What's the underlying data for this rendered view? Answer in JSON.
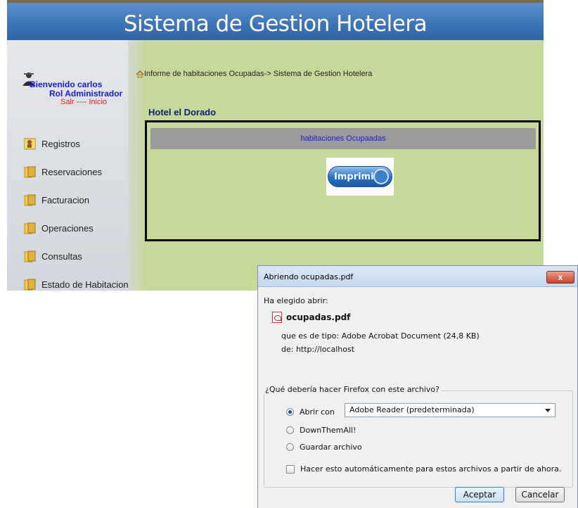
{
  "header": {
    "title": "Sistema de Gestion Hotelera"
  },
  "sidebar": {
    "welcome": "Bienvenido carlos",
    "role": "Rol Administrador",
    "logout": "Salr",
    "separator": "----",
    "home": "Inicio",
    "items": [
      {
        "label": "Registros",
        "icon": "users-icon"
      },
      {
        "label": "Reservaciones",
        "icon": "folder-icon"
      },
      {
        "label": "Facturacion",
        "icon": "folder-icon"
      },
      {
        "label": "Operaciones",
        "icon": "folder-icon"
      },
      {
        "label": "Consultas",
        "icon": "folder-icon"
      },
      {
        "label": "Estado de Habitaciones",
        "icon": "folder-icon"
      }
    ]
  },
  "main": {
    "breadcrumb": "Informe de habitaciones Ocupadas-> Sistema de Gestion Hotelera",
    "hotel_name": "Hotel el Dorado",
    "report_title": "habitaciones Ocupaadas",
    "print_button": "Imprimir"
  },
  "dialog": {
    "title": "Abriendo ocupadas.pdf",
    "close": "x",
    "intro": "Ha elegido abrir:",
    "file_name": "ocupadas.pdf",
    "type_line": "que es de tipo:  Adobe Acrobat Document (24,8 KB)",
    "from_line": "de:  http://localhost",
    "question": "¿Qué debería hacer Firefox con este archivo?",
    "open_with_label": "Abrir con",
    "open_with_value": "Adobe Reader  (predeterminada)",
    "downthemall_label": "DownThemAll!",
    "save_label": "Guardar archivo",
    "auto_label": "Hacer esto automáticamente para estos archivos a partir de ahora.",
    "accept": "Aceptar",
    "cancel": "Cancelar"
  },
  "colors": {
    "header_blue": "#3f76b8",
    "content_green": "#c7d99a",
    "link_red": "#d9261c",
    "user_blue": "#1a1ad0"
  }
}
